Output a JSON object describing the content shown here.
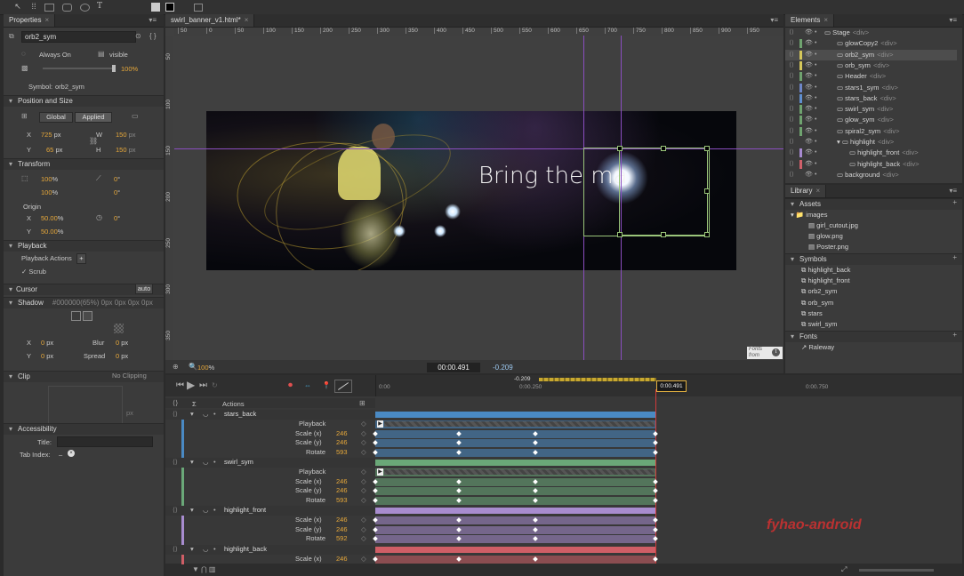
{
  "toolbar": {
    "icons": [
      "selection-arrow-icon",
      "transform-icon",
      "rectangle-tool-icon",
      "rounded-rect-icon",
      "ellipse-tool-icon",
      "text-tool-icon",
      "fill-swatch-icon",
      "stroke-swatch-icon",
      "clip-tool-icon"
    ]
  },
  "properties": {
    "tab_label": "Properties",
    "symbol_name": "orb2_sym",
    "always_on": "Always On",
    "visible": "visible",
    "opacity": "100",
    "opacity_unit": "%",
    "symbol_label": "Symbol:",
    "symbol_value": "orb2_sym",
    "position_size": {
      "title": "Position and Size",
      "global": "Global",
      "applied": "Applied",
      "x_label": "X",
      "x_value": "725",
      "x_unit": "px",
      "y_label": "Y",
      "y_value": "65",
      "y_unit": "px",
      "w_label": "W",
      "w_value": "150",
      "w_unit": "px",
      "h_label": "H",
      "h_value": "150",
      "h_unit": "px"
    },
    "transform": {
      "title": "Transform",
      "scale_x": "100",
      "scale_y": "100",
      "pct": "%",
      "skew_x": "0",
      "skew_y": "0",
      "deg": "°",
      "origin_label": "Origin",
      "origin_x_label": "X",
      "origin_x": "50.00",
      "origin_y_label": "Y",
      "origin_y": "50.00",
      "rotate": "0"
    },
    "playback": {
      "title": "Playback",
      "actions": "Playback Actions",
      "scrub": "Scrub"
    },
    "cursor": {
      "title": "Cursor",
      "auto": "auto"
    },
    "shadow": {
      "title": "Shadow",
      "summary": "#000000(65%) 0px 0px 0px 0px",
      "x_label": "X",
      "x_value": "0",
      "y_label": "Y",
      "y_value": "0",
      "blur_label": "Blur",
      "blur_value": "0",
      "spread_label": "Spread",
      "spread_value": "0",
      "unit": "px"
    },
    "clip": {
      "title": "Clip",
      "value": "No Clipping",
      "unit": "px"
    },
    "accessibility": {
      "title": "Accessibility",
      "title_label": "Title:",
      "tab_index_label": "Tab Index:",
      "tab_index_value": "–"
    }
  },
  "stage": {
    "tab_label": "swirl_banner_v1.html*",
    "ruler_marks": [
      "50",
      "0",
      "50",
      "100",
      "150",
      "200",
      "250",
      "300",
      "350",
      "400",
      "450",
      "500",
      "550",
      "600",
      "650",
      "700",
      "750",
      "800",
      "850",
      "900",
      "950"
    ],
    "vruler_marks": [
      "50",
      "100",
      "150",
      "200",
      "250",
      "300",
      "350"
    ],
    "banner_text": "Bring the ma",
    "zoom": "100",
    "zoom_unit": "%",
    "fonts_badge": "Fonts from"
  },
  "elements": {
    "tab_label": "Elements",
    "items": [
      {
        "name": "Stage",
        "tag": "<div>",
        "color": "",
        "indent": 0
      },
      {
        "name": "glowCopy2",
        "tag": "<div>",
        "color": "#6fa36f",
        "indent": 1
      },
      {
        "name": "orb2_sym",
        "tag": "<div>",
        "color": "#d4c75a",
        "indent": 1
      },
      {
        "name": "orb_sym",
        "tag": "<div>",
        "color": "#d4c75a",
        "indent": 1
      },
      {
        "name": "Header",
        "tag": "<div>",
        "color": "#6fa36f",
        "indent": 1
      },
      {
        "name": "stars1_sym",
        "tag": "<div>",
        "color": "#6e86c8",
        "indent": 1
      },
      {
        "name": "stars_back",
        "tag": "<div>",
        "color": "#5f8fd0",
        "indent": 1
      },
      {
        "name": "swirl_sym",
        "tag": "<div>",
        "color": "#6fa36f",
        "indent": 1
      },
      {
        "name": "glow_sym",
        "tag": "<div>",
        "color": "#6fa36f",
        "indent": 1
      },
      {
        "name": "spiral2_sym",
        "tag": "<div>",
        "color": "#6fa36f",
        "indent": 1
      },
      {
        "name": "highlight",
        "tag": "<div>",
        "color": "",
        "indent": 1
      },
      {
        "name": "highlight_front",
        "tag": "<div>",
        "color": "#a78ad0",
        "indent": 2
      },
      {
        "name": "highlight_back",
        "tag": "<div>",
        "color": "#d0606a",
        "indent": 2
      },
      {
        "name": "background",
        "tag": "<div>",
        "color": "",
        "indent": 1
      }
    ]
  },
  "library": {
    "tab_label": "Library",
    "assets_title": "Assets",
    "images_label": "images",
    "images": [
      "girl_cutout.jpg",
      "glow.png",
      "Poster.png"
    ],
    "symbols_title": "Symbols",
    "symbols": [
      "highlight_back",
      "highlight_front",
      "orb2_sym",
      "orb_sym",
      "stars",
      "swirl_sym"
    ],
    "fonts_title": "Fonts",
    "fonts": [
      "Raleway"
    ]
  },
  "timeline": {
    "current_time": "00:00.491",
    "offset": "-0.209",
    "marker_offset": "-0.209",
    "playhead_label": "0:00.491",
    "ticks": [
      "0:00",
      "0:00.250",
      "0:00.750"
    ],
    "actions_label": "Actions",
    "watermark": "fyhao-android",
    "tracks": [
      {
        "name": "stars_back",
        "color": "#4a8ac4",
        "rows": [
          {
            "label": "Playback",
            "value": ""
          },
          {
            "label": "Scale (x)",
            "value": "246"
          },
          {
            "label": "Scale (y)",
            "value": "246"
          },
          {
            "label": "Rotate",
            "value": "593"
          }
        ]
      },
      {
        "name": "swirl_sym",
        "color": "#6aa878",
        "rows": [
          {
            "label": "Playback",
            "value": ""
          },
          {
            "label": "Scale (x)",
            "value": "246"
          },
          {
            "label": "Scale (y)",
            "value": "246"
          },
          {
            "label": "Rotate",
            "value": "593"
          }
        ]
      },
      {
        "name": "highlight_front",
        "color": "#a88ccf",
        "rows": [
          {
            "label": "Scale (x)",
            "value": "246"
          },
          {
            "label": "Scale (y)",
            "value": "246"
          },
          {
            "label": "Rotate",
            "value": "592"
          }
        ]
      },
      {
        "name": "highlight_back",
        "color": "#cf5e66",
        "rows": [
          {
            "label": "Scale (x)",
            "value": "246"
          }
        ]
      }
    ]
  }
}
